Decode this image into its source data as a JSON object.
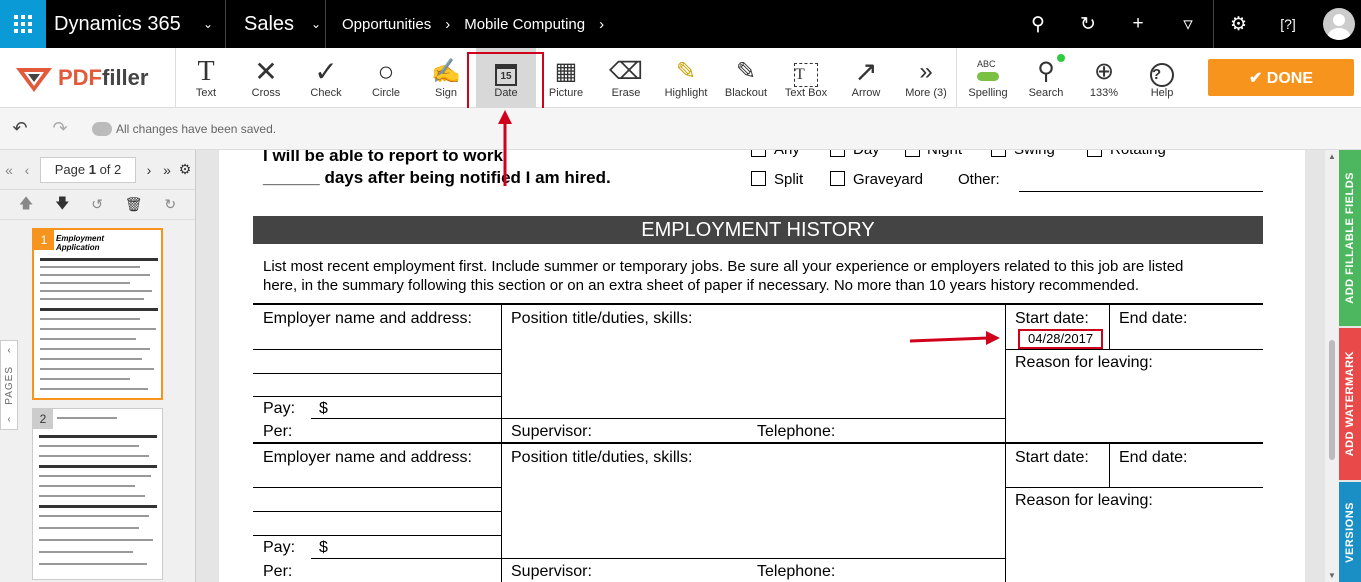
{
  "topbar": {
    "app_name": "Dynamics 365",
    "module": "Sales",
    "breadcrumb": [
      "Opportunities",
      "Mobile Computing"
    ],
    "icons": [
      "search-icon",
      "history-icon",
      "add-icon",
      "filter-icon",
      "settings-icon",
      "help-icon",
      "avatar"
    ]
  },
  "toolbar": {
    "logo_pdf": "PDF",
    "logo_filler": "filler",
    "tools": [
      {
        "label": "Text",
        "icon": "T"
      },
      {
        "label": "Cross",
        "icon": "✕"
      },
      {
        "label": "Check",
        "icon": "✓"
      },
      {
        "label": "Circle",
        "icon": "○"
      },
      {
        "label": "Sign",
        "icon": "✍"
      },
      {
        "label": "Date",
        "icon": "15"
      },
      {
        "label": "Picture",
        "icon": "▨"
      },
      {
        "label": "Erase",
        "icon": "⌫"
      },
      {
        "label": "Highlight",
        "icon": "✎"
      },
      {
        "label": "Blackout",
        "icon": "✎"
      },
      {
        "label": "Text Box",
        "icon": "T"
      },
      {
        "label": "Arrow",
        "icon": "↗"
      },
      {
        "label": "More (3)",
        "icon": "»"
      }
    ],
    "right_tools": [
      {
        "label": "Spelling",
        "icon": "ABC"
      },
      {
        "label": "Search",
        "icon": "🔍"
      },
      {
        "label": "133%",
        "icon": "⊕"
      },
      {
        "label": "Help",
        "icon": "?"
      }
    ],
    "done_label": "✔ DONE"
  },
  "savebar": {
    "message": "All changes have been saved."
  },
  "pager": {
    "page_prefix": "Page",
    "current": "1",
    "of_label": "of 2",
    "pages_tab": "PAGES"
  },
  "thumbnails": [
    {
      "num": "1",
      "title": "Employment Application"
    },
    {
      "num": "2"
    }
  ],
  "document": {
    "report_line1": "I will be able to report to work",
    "report_line2": "______ days after being notified I am hired.",
    "shift_options": [
      "Any",
      "Day",
      "Night",
      "Swing",
      "Rotating",
      "Split",
      "Graveyard"
    ],
    "other_label": "Other:",
    "section_title": "EMPLOYMENT HISTORY",
    "instructions_line1": "List most recent employment first. Include summer or temporary jobs. Be sure all your experience or employers related to this job are listed",
    "instructions_line2": "here, in the summary following this section or on an extra sheet of paper if necessary. No more than 10 years history recommended.",
    "employer_label": "Employer name and address:",
    "position_label": "Position title/duties, skills:",
    "start_label": "Start date:",
    "end_label": "End date:",
    "reason_label": "Reason for leaving:",
    "pay_label": "Pay:",
    "dollar": "$",
    "per_label": "Per:",
    "supervisor_label": "Supervisor:",
    "telephone_label": "Telephone:",
    "start_date_value": "04/28/2017"
  },
  "side_tabs": [
    {
      "label": "ADD FILLABLE FIELDS",
      "color": "#4cb75e"
    },
    {
      "label": "ADD WATERMARK",
      "color": "#e84a4a"
    },
    {
      "label": "VERSIONS",
      "color": "#1a8fc6"
    }
  ],
  "colors": {
    "accent_orange": "#f7941d",
    "dynamics_blue": "#0a9bd6",
    "annotation_red": "#d0021b"
  }
}
